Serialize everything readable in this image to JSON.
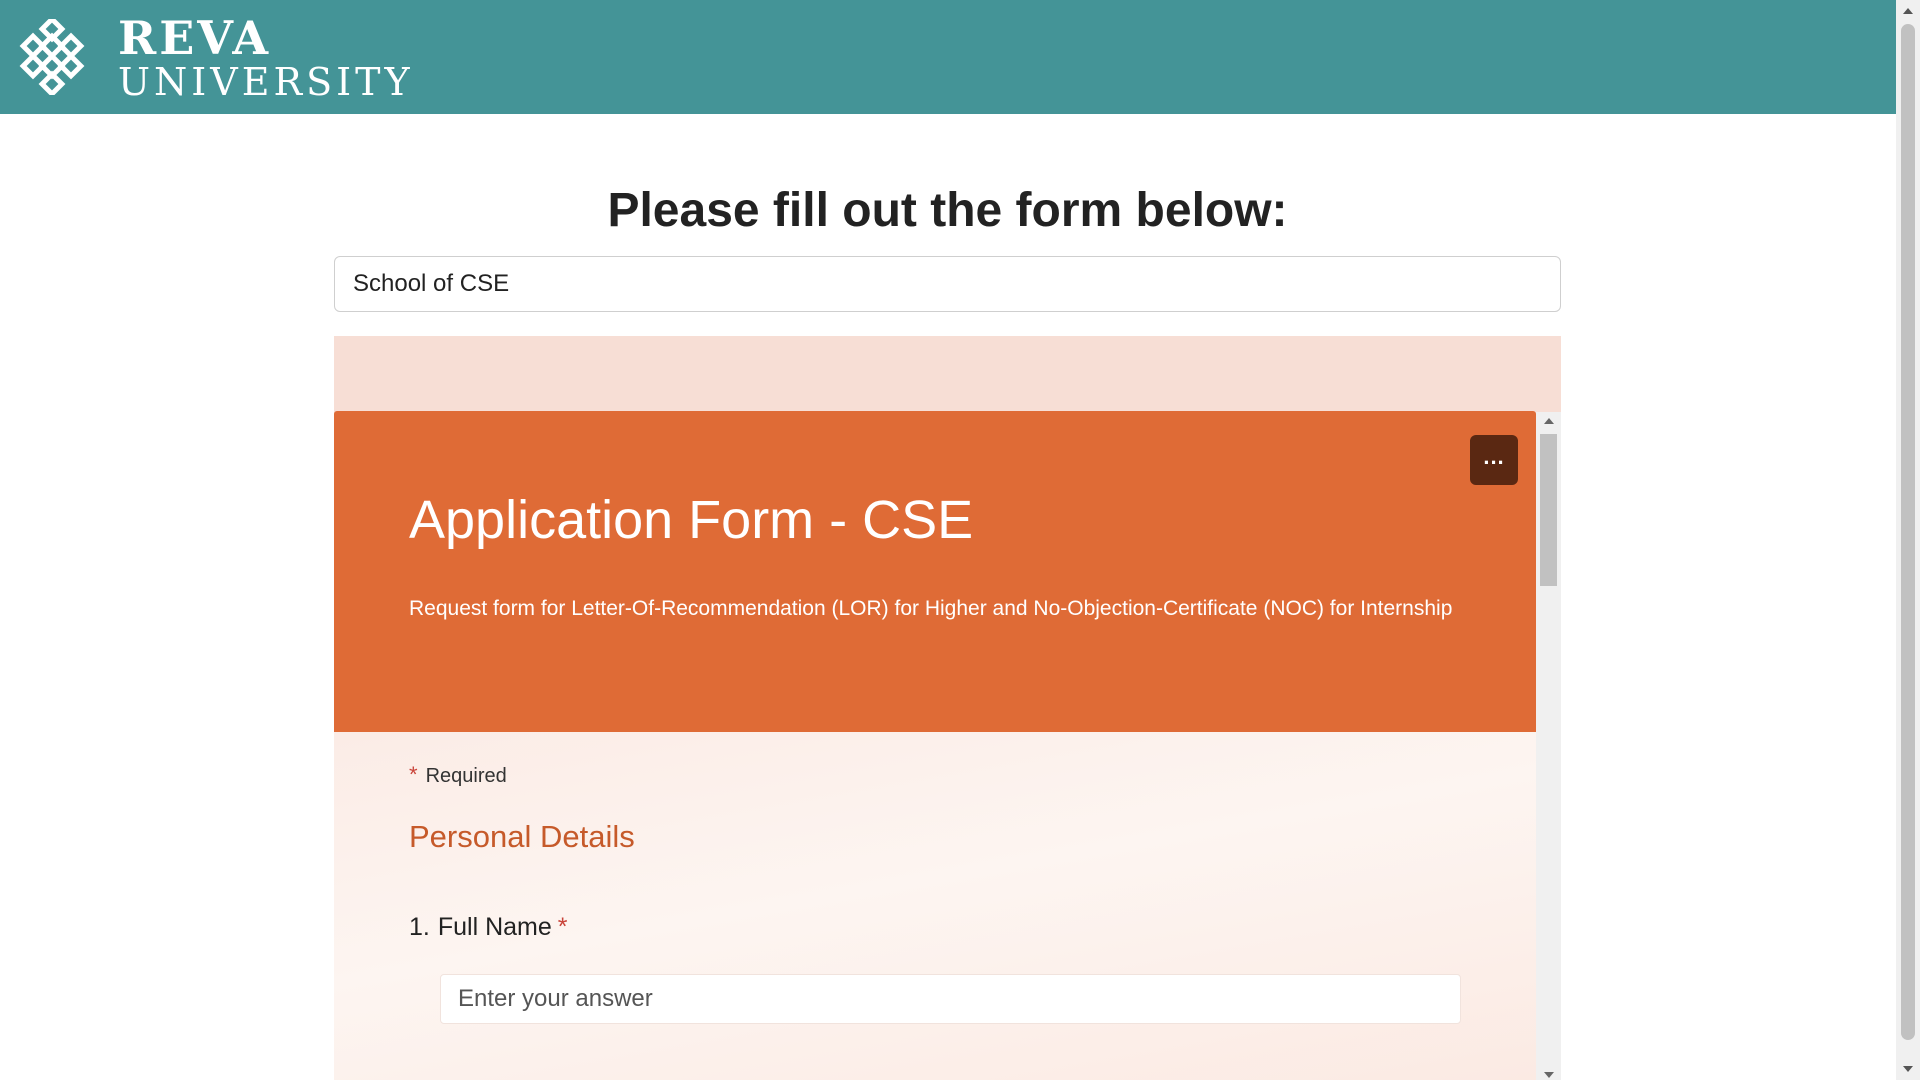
{
  "header": {
    "logo_line1": "REVA",
    "logo_line2": "UNIVERSITY",
    "logo_icon": "reva-knot-icon",
    "bg_color": "#449497"
  },
  "main": {
    "heading": "Please fill out the form below:",
    "school_select": {
      "value": "School of CSE"
    }
  },
  "form": {
    "more_button_label": "...",
    "more_icon": "ellipsis-icon",
    "title": "Application Form - CSE",
    "description": "Request form for Letter-Of-Recommendation (LOR) for Higher and No-Objection-Certificate (NOC) for Internship",
    "required_star": "*",
    "required_label": "Required",
    "section_title": "Personal Details",
    "questions": [
      {
        "number": "1.",
        "label": "Full Name",
        "required_star": "*",
        "placeholder": "Enter your answer"
      }
    ],
    "colors": {
      "banner": "#df6b36",
      "accent_text": "#c65a2a",
      "required": "#c9443a",
      "frame_bg": "#f7ded5"
    }
  }
}
